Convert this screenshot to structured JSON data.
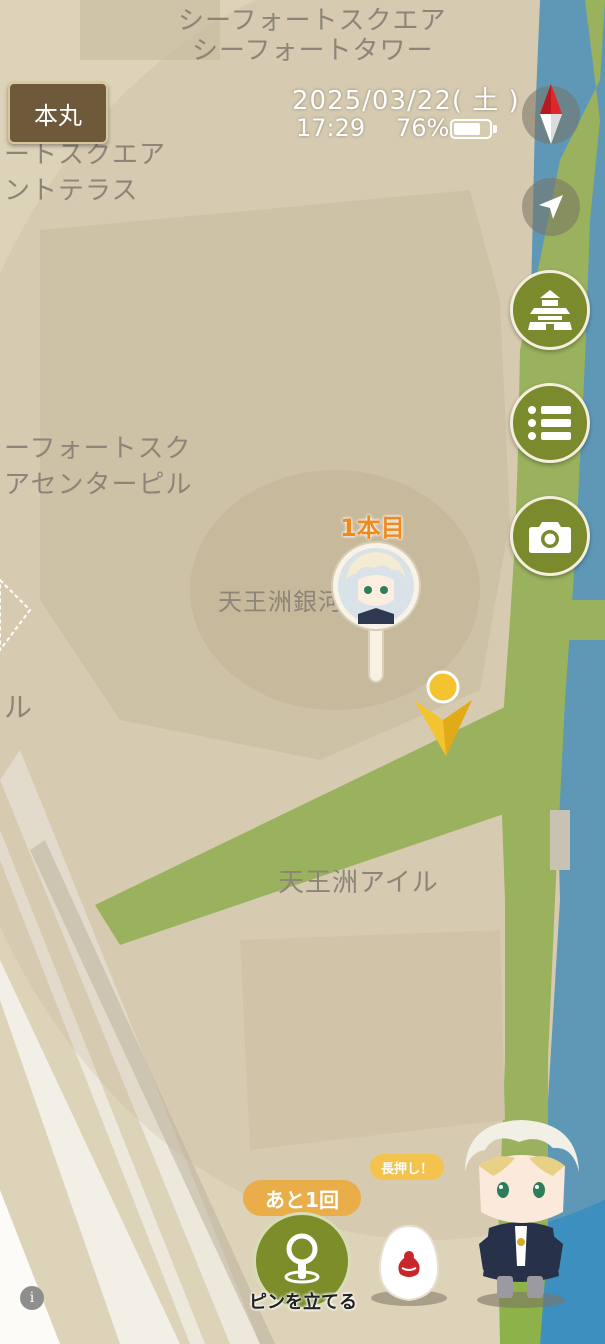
{
  "map": {
    "labels": {
      "seaforte_square": "シーフォートスクエア",
      "seaforte_tower": "シーフォートタワー",
      "square_left_1": "ートスクエア",
      "square_left_2": "ントテラス",
      "center_building_1": "ーフォートスク",
      "center_building_2": "アセンターピル",
      "ginga_theater": "天王洲銀河劇場",
      "isle": "天王洲アイル",
      "left_cut": "ル"
    },
    "colors": {
      "land": "#ddd3b8",
      "park": "#8db24a",
      "water": "#3d8fbf",
      "road": "#ece8dc"
    }
  },
  "header": {
    "home_button": "本丸",
    "date": "2025/03/22( 土 )",
    "time": "17:29",
    "battery_text": "76%",
    "battery_level": 0.76
  },
  "controls": {
    "compass_icon": "compass-icon",
    "locate_icon": "navigation-arrow-icon",
    "castle_icon": "castle-icon",
    "menu_icon": "list-icon",
    "camera_icon": "camera-icon"
  },
  "pin": {
    "label": "1本目"
  },
  "bottom": {
    "remaining": "あと1回",
    "long_press": "長押し！",
    "place_pin": "ピンを立てる",
    "info": "i"
  }
}
